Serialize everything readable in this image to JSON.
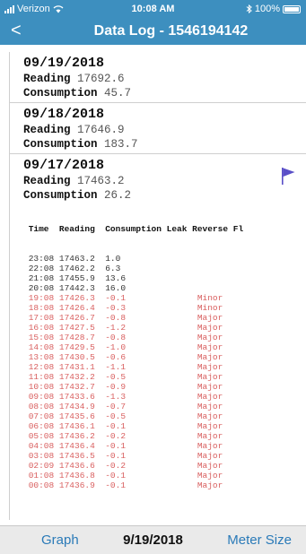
{
  "status_bar": {
    "carrier": "Verizon",
    "time": "10:08 AM",
    "battery": "100%"
  },
  "nav": {
    "back_label": "<",
    "title": "Data Log - 1546194142"
  },
  "labels": {
    "reading": "Reading",
    "consumption": "Consumption"
  },
  "entries": [
    {
      "date": "09/19/2018",
      "reading": "17692.6",
      "consumption": "45.7"
    },
    {
      "date": "09/18/2018",
      "reading": "17646.9",
      "consumption": "183.7"
    },
    {
      "date": "09/17/2018",
      "reading": "17463.2",
      "consumption": "26.2"
    }
  ],
  "log_table": {
    "header": " Time  Reading  Consumption Leak Reverse Fl",
    "rows": [
      {
        "text": " 23:08 17463.2  1.0",
        "red": false
      },
      {
        "text": " 22:08 17462.2  6.3",
        "red": false
      },
      {
        "text": " 21:08 17455.9  13.6",
        "red": false
      },
      {
        "text": " 20:08 17442.3  16.0",
        "red": false
      },
      {
        "text": " 19:08 17426.3  -0.1              Minor",
        "red": true
      },
      {
        "text": " 18:08 17426.4  -0.3              Minor",
        "red": true
      },
      {
        "text": " 17:08 17426.7  -0.8              Major",
        "red": true
      },
      {
        "text": " 16:08 17427.5  -1.2              Major",
        "red": true
      },
      {
        "text": " 15:08 17428.7  -0.8              Major",
        "red": true
      },
      {
        "text": " 14:08 17429.5  -1.0              Major",
        "red": true
      },
      {
        "text": " 13:08 17430.5  -0.6              Major",
        "red": true
      },
      {
        "text": " 12:08 17431.1  -1.1              Major",
        "red": true
      },
      {
        "text": " 11:08 17432.2  -0.5              Major",
        "red": true
      },
      {
        "text": " 10:08 17432.7  -0.9              Major",
        "red": true
      },
      {
        "text": " 09:08 17433.6  -1.3              Major",
        "red": true
      },
      {
        "text": " 08:08 17434.9  -0.7              Major",
        "red": true
      },
      {
        "text": " 07:08 17435.6  -0.5              Major",
        "red": true
      },
      {
        "text": " 06:08 17436.1  -0.1              Major",
        "red": true
      },
      {
        "text": " 05:08 17436.2  -0.2              Major",
        "red": true
      },
      {
        "text": " 04:08 17436.4  -0.1              Major",
        "red": true
      },
      {
        "text": " 03:08 17436.5  -0.1              Major",
        "red": true
      },
      {
        "text": " 02:09 17436.6  -0.2              Major",
        "red": true
      },
      {
        "text": " 01:08 17436.8  -0.1              Major",
        "red": true
      },
      {
        "text": " 00:08 17436.9  -0.1              Major",
        "red": true
      }
    ]
  },
  "toolbar": {
    "left_label": "Graph",
    "center_label": "9/19/2018",
    "right_label": "Meter Size"
  },
  "icons": {
    "flag": "flag-icon",
    "wifi": "wifi-icon",
    "bluetooth": "bluetooth-icon",
    "battery": "battery-icon",
    "signal": "signal-bars-icon"
  },
  "colors": {
    "header_blue": "#3d8fbf",
    "link_blue": "#2a7ab8",
    "alert_red": "#d96060",
    "flag_purple": "#5a4fc8",
    "toolbar_gray": "#eaeaea"
  }
}
